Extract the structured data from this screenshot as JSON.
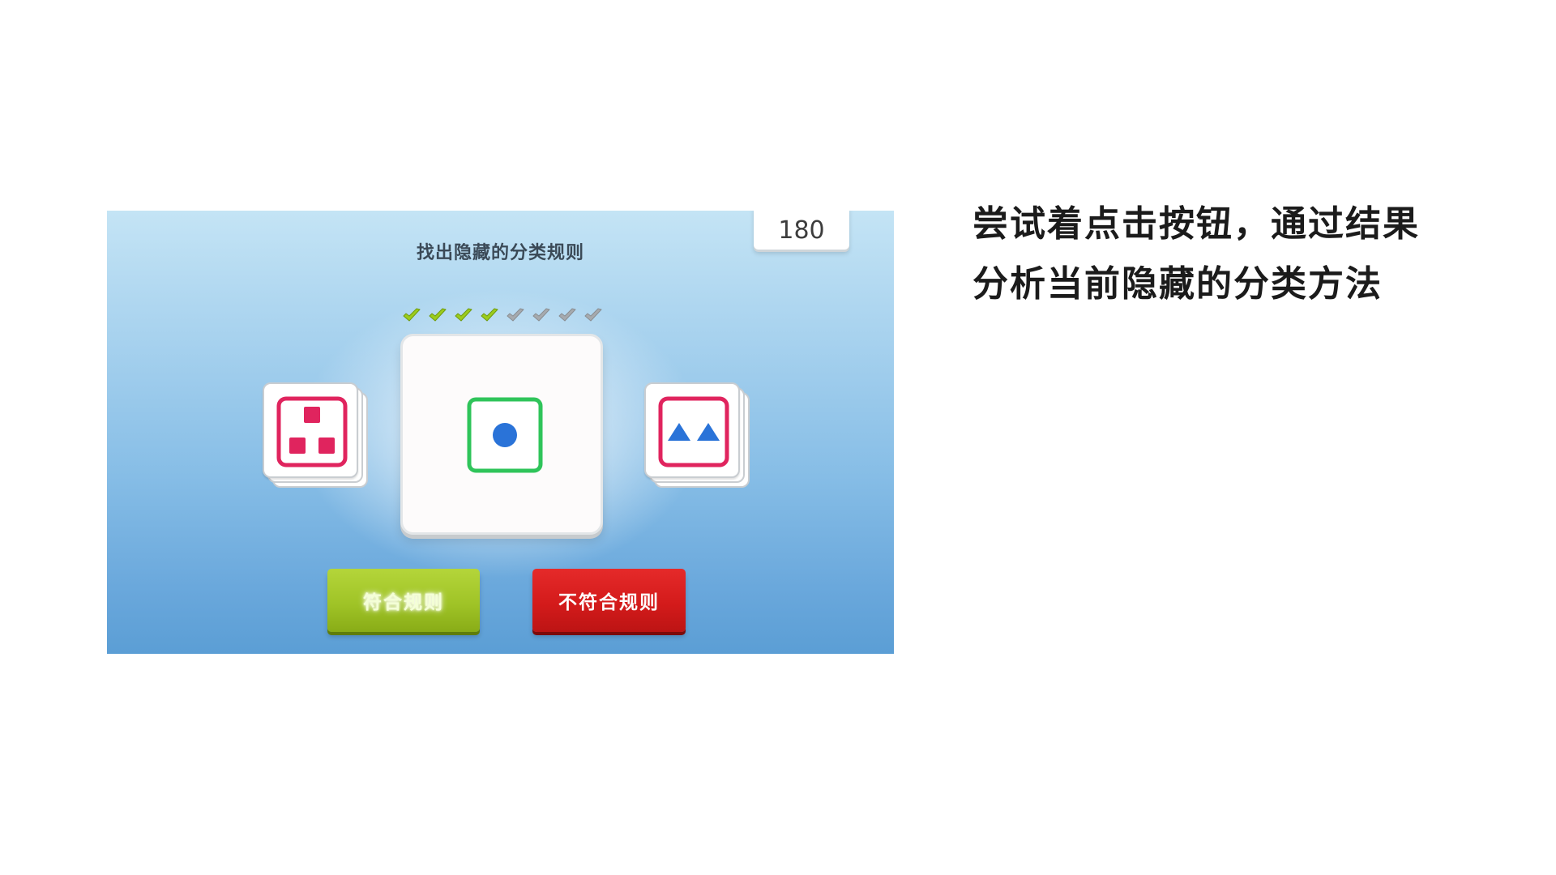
{
  "game": {
    "score": "180",
    "title": "找出隐藏的分类规则",
    "progress": {
      "completed": 4,
      "total": 8
    },
    "cards": {
      "left_deck": {
        "symbol": "square",
        "count": 3,
        "symbol_color": "#e0245e",
        "frame_color": "#e0245e"
      },
      "center": {
        "symbol": "circle",
        "count": 1,
        "symbol_color": "#2a73d8",
        "frame_color": "#2fc45a"
      },
      "right_deck": {
        "symbol": "triangle",
        "count": 2,
        "symbol_color": "#2a73d8",
        "frame_color": "#e0245e"
      }
    },
    "buttons": {
      "match_label": "符合规则",
      "no_match_label": "不符合规则"
    },
    "colors": {
      "check_done": "#9ccc1c",
      "check_todo": "#a6aaae",
      "match_button": "#a0c427",
      "no_match_button": "#d41b1b"
    }
  },
  "instructions": {
    "line1": "尝试着点击按钮，通过结果",
    "line2": "分析当前隐藏的分类方法"
  }
}
